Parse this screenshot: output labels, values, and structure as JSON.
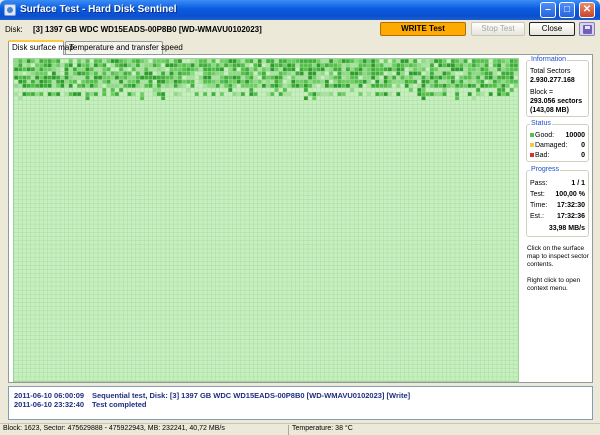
{
  "window": {
    "title": "Surface Test - Hard Disk Sentinel"
  },
  "toolbar": {
    "disk_label": "Disk:",
    "disk_value": "[3] 1397 GB   WDC WD15EADS-00P8B0 [WD-WMAVU0102023]",
    "write_test_label": "WRITE Test",
    "stop_test_label": "Stop Test",
    "close_label": "Close"
  },
  "tabs": [
    {
      "label": "Disk surface map",
      "active": true
    },
    {
      "label": "Temperature and transfer speed",
      "active": false
    }
  ],
  "information": {
    "title": "Information",
    "total_sectors_label": "Total Sectors",
    "total_sectors_value": "2.930.277.168",
    "block_label": "Block =",
    "block_sectors": "293.056 sectors",
    "block_size": "(143,08 MB)"
  },
  "status": {
    "title": "Status",
    "good_label": "Good:",
    "good_value": "10000",
    "damaged_label": "Damaged:",
    "damaged_value": "0",
    "bad_label": "Bad:",
    "bad_value": "0",
    "colors": {
      "good": "#55c04b",
      "damaged": "#e8d040",
      "bad": "#d83030"
    }
  },
  "progress": {
    "title": "Progress",
    "pass_label": "Pass:",
    "pass_value": "1 / 1",
    "test_label": "Test:",
    "test_value": "100,00 %",
    "time_label": "Time:",
    "time_value": "17:32:30",
    "est_label": "Est.:",
    "est_value": "17:32:36",
    "speed": "33,98 MB/s"
  },
  "hints": {
    "click": "Click on the surface map to inspect sector contents.",
    "right_click": "Right click to open context menu."
  },
  "log": [
    {
      "time": "2011-06-10 06:00:09",
      "message": "Sequential test, Disk: [3] 1397 GB   WDC WD15EADS-00P8B0 [WD-WMAVU0102023] [Write]"
    },
    {
      "time": "2011-06-10 23:32:40",
      "message": "Test completed"
    }
  ],
  "statusbar": {
    "block_info": "Block: 1623, Sector: 475629888 - 475922943, MB: 232241, 40,72 MB/s",
    "temperature": "Temperature: 38  °C"
  },
  "surface_colors": {
    "base": "#c8efbf",
    "grid": "#a9dea2"
  }
}
